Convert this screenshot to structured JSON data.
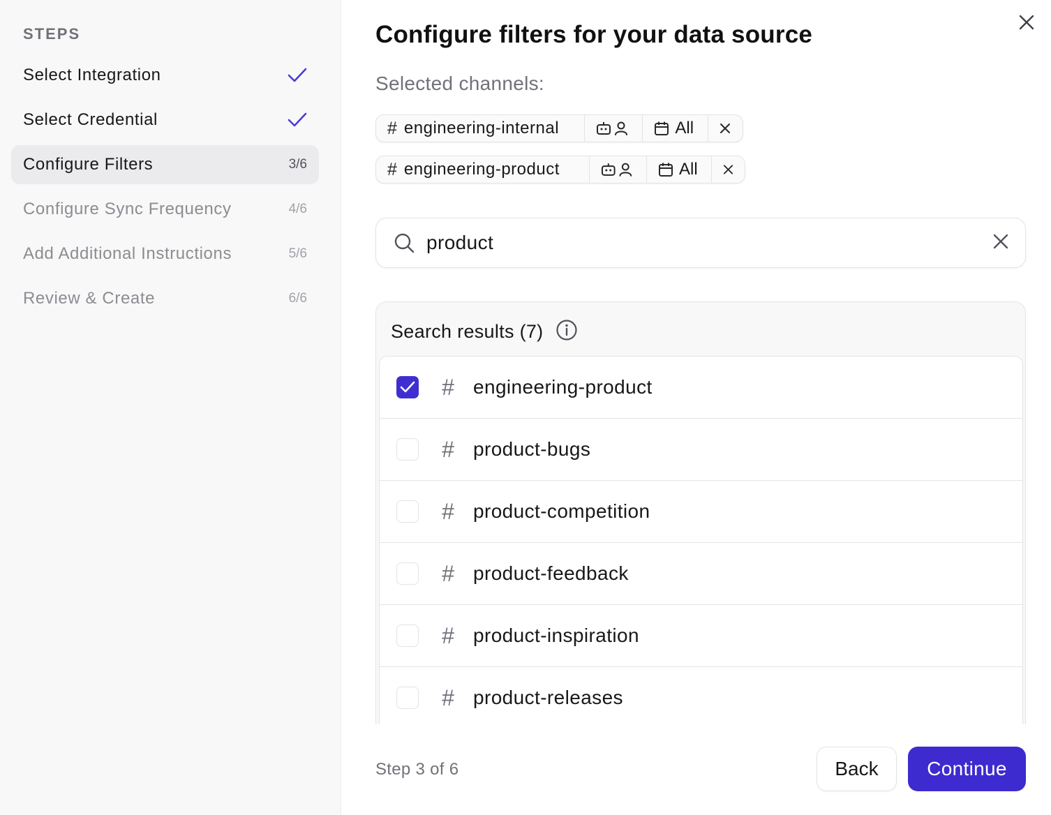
{
  "sidebar": {
    "heading": "STEPS",
    "steps": [
      {
        "label": "Select Integration",
        "status": "done"
      },
      {
        "label": "Select Credential",
        "status": "done"
      },
      {
        "label": "Configure Filters",
        "count": "3/6",
        "status": "active"
      },
      {
        "label": "Configure Sync Frequency",
        "count": "4/6",
        "status": "pending"
      },
      {
        "label": "Add Additional Instructions",
        "count": "5/6",
        "status": "pending"
      },
      {
        "label": "Review & Create",
        "count": "6/6",
        "status": "pending"
      }
    ]
  },
  "main": {
    "title": "Configure filters for your data source",
    "selected_label": "Selected channels:",
    "selected_channels": [
      {
        "hash": "#",
        "name": "engineering-internal",
        "date_filter": "All"
      },
      {
        "hash": "#",
        "name": "engineering-product",
        "date_filter": "All"
      }
    ],
    "search": {
      "value": "product"
    },
    "results": {
      "header": "Search results (7)",
      "items": [
        {
          "hash": "#",
          "name": "engineering-product",
          "checked": true
        },
        {
          "hash": "#",
          "name": "product-bugs",
          "checked": false
        },
        {
          "hash": "#",
          "name": "product-competition",
          "checked": false
        },
        {
          "hash": "#",
          "name": "product-feedback",
          "checked": false
        },
        {
          "hash": "#",
          "name": "product-inspiration",
          "checked": false
        },
        {
          "hash": "#",
          "name": "product-releases",
          "checked": false
        }
      ]
    }
  },
  "footer": {
    "step_text": "Step 3 of 6",
    "back_label": "Back",
    "continue_label": "Continue"
  },
  "colors": {
    "accent": "#3d2bcf",
    "checkmark": "#4a3bd6"
  }
}
